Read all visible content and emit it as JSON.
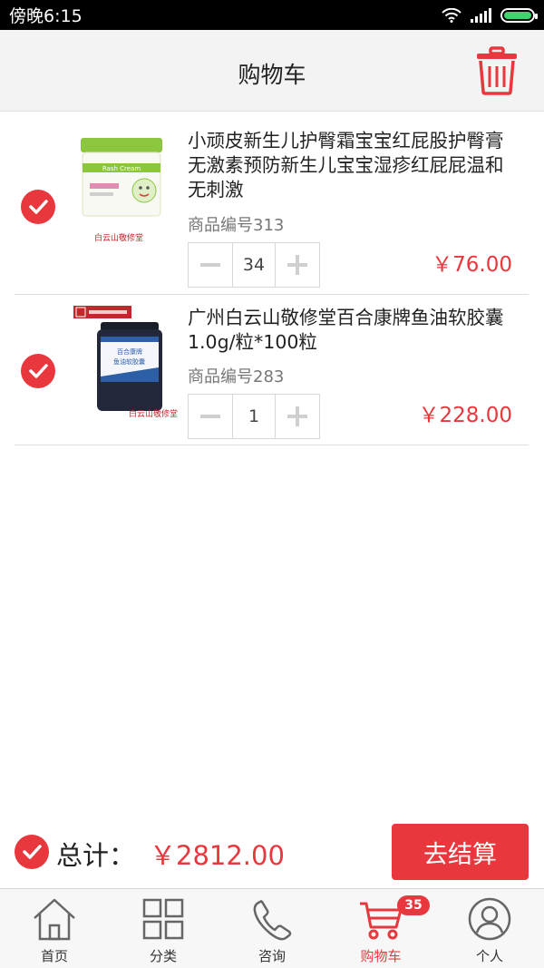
{
  "status_bar": {
    "time": "傍晚6:15"
  },
  "header": {
    "title": "购物车",
    "delete_icon": "trash-icon"
  },
  "cart": {
    "items": [
      {
        "name": "小顽皮新生儿护臀霜宝宝红屁股护臀膏无激素预防新生儿宝宝湿疹红屁屁温和无刺激",
        "code": "商品编号313",
        "quantity": "34",
        "price": "￥76.00",
        "checked": true,
        "image_label": "Diaper Rash Cream",
        "image_brand": "白云山敬修堂"
      },
      {
        "name": "广州白云山敬修堂百合康牌鱼油软胶囊 1.0g/粒*100粒",
        "code": "商品编号283",
        "quantity": "1",
        "price": "￥228.00",
        "checked": true,
        "image_label": "百合康牌鱼油软胶囊",
        "image_brand": "白云山敬修堂"
      }
    ]
  },
  "footer": {
    "total_label": "总计：",
    "total_value": "￥2812.00",
    "checkout_label": "去结算",
    "select_all_checked": true
  },
  "tabs": [
    {
      "label": "首页",
      "icon": "home-icon",
      "active": false
    },
    {
      "label": "分类",
      "icon": "grid-icon",
      "active": false
    },
    {
      "label": "咨询",
      "icon": "phone-icon",
      "active": false
    },
    {
      "label": "购物车",
      "icon": "cart-icon",
      "active": true,
      "badge": "35"
    },
    {
      "label": "个人",
      "icon": "person-icon",
      "active": false
    }
  ],
  "colors": {
    "accent": "#e8373d",
    "header_bg": "#f3f3f3",
    "divider": "#dedede"
  }
}
